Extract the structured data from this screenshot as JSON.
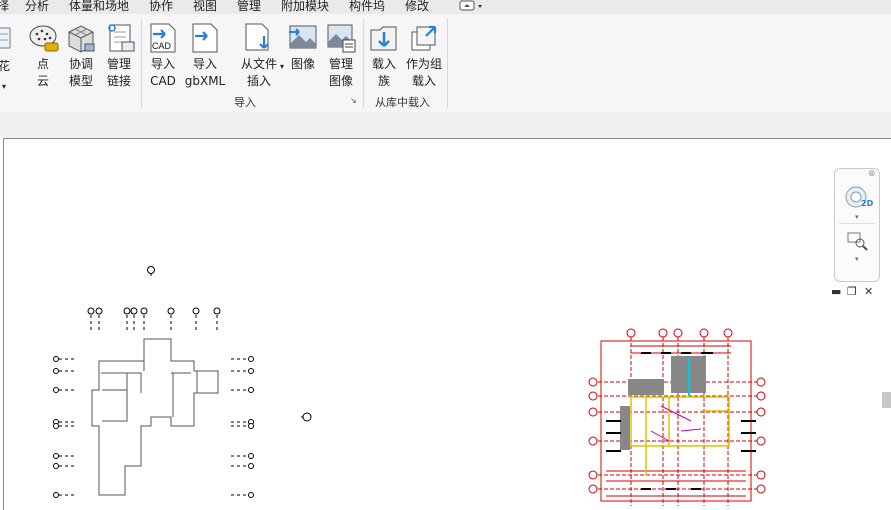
{
  "menu": {
    "items": [
      "择",
      "分析",
      "体量和场地",
      "协作",
      "视图",
      "管理",
      "附加模块",
      "构件坞",
      "修改"
    ]
  },
  "ribbon": {
    "create": {
      "flower_label": "花",
      "pointcloud_label": "点\n云",
      "coordination_label": "协调\n模型",
      "manage_links_label": "管理\n链接"
    },
    "import": {
      "cad_icon_text": "CAD",
      "cad_label": "导入\nCAD",
      "gbxml_label": "导入\ngbXML",
      "from_file_label": "从文件\n插入",
      "image_label": "图像",
      "manage_images_label": "管理\n图像",
      "group_label": "导入"
    },
    "library": {
      "load_family_label": "载入\n族",
      "load_as_group_label": "作为组\n载入",
      "group_label": "从库中载入"
    }
  },
  "viewcube": {
    "badge": "2D"
  },
  "colors": {
    "accent": "#2a7fd4",
    "plan_red": "#d40000",
    "plan_yellow": "#e0c000"
  }
}
